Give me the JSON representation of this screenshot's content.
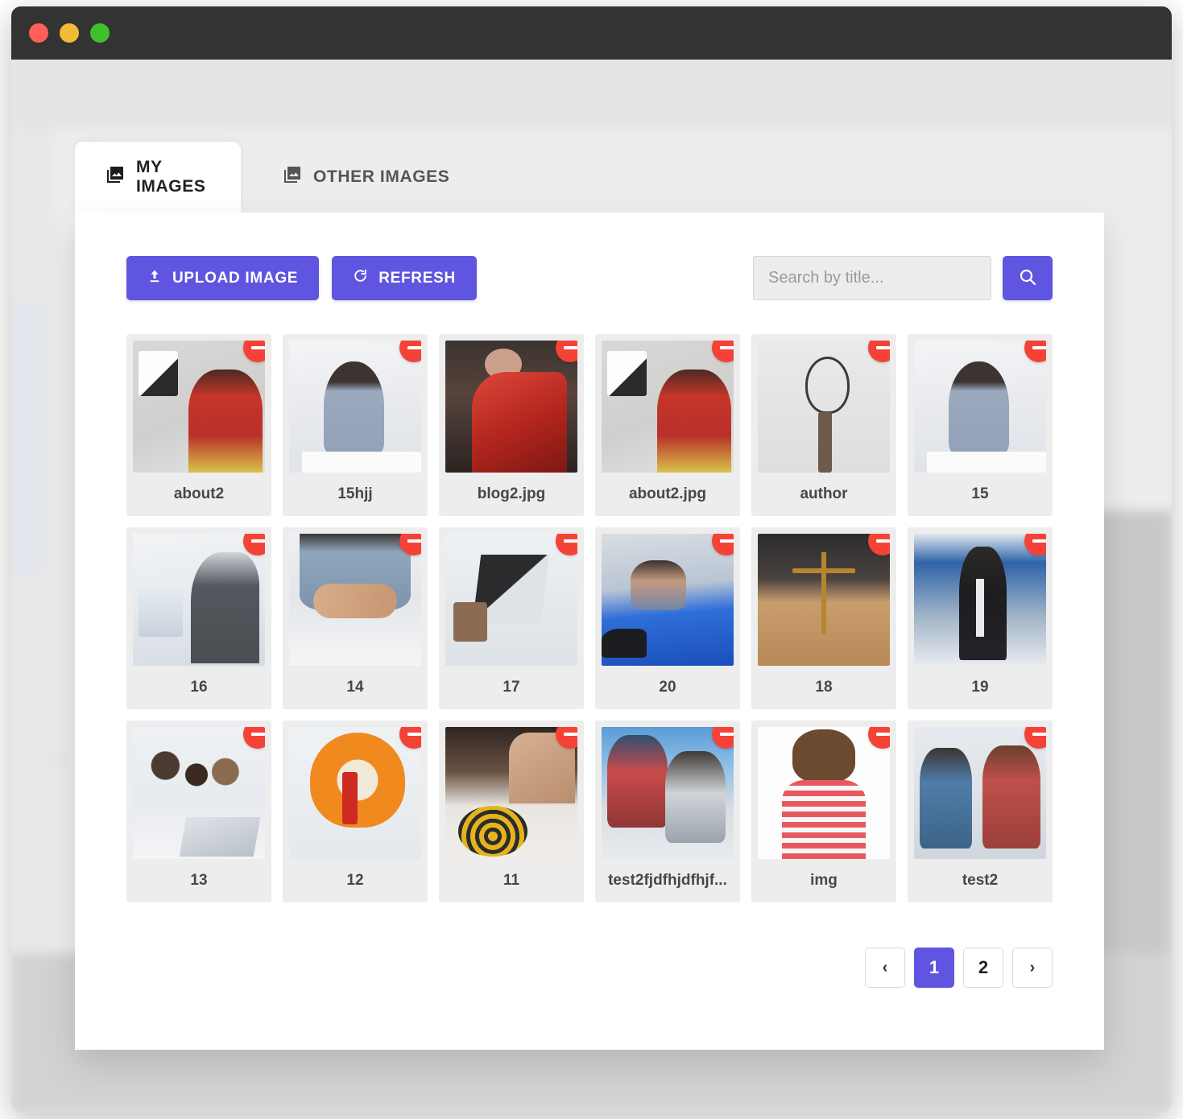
{
  "window": {
    "traffic_lights": [
      "close",
      "minimize",
      "maximize"
    ]
  },
  "tabs": [
    {
      "id": "my-images",
      "label": "MY IMAGES",
      "icon": "photo-library-icon",
      "active": true
    },
    {
      "id": "other-images",
      "label": "OTHER IMAGES",
      "icon": "photo-library-icon",
      "active": false
    }
  ],
  "toolbar": {
    "upload_label": "UPLOAD IMAGE",
    "upload_icon": "upload-icon",
    "refresh_label": "REFRESH",
    "refresh_icon": "refresh-icon"
  },
  "search": {
    "placeholder": "Search by title...",
    "value": "",
    "button_icon": "search-icon"
  },
  "colors": {
    "accent": "#6055e0",
    "remove": "#f44336",
    "card_bg": "#ededed",
    "panel_bg": "#ffffff",
    "titlebar": "#333333"
  },
  "grid": {
    "remove_icon": "minus-circle-icon",
    "items": [
      {
        "title": "about2",
        "art": "art-studio"
      },
      {
        "title": "15hjj",
        "art": "art-desk-woman"
      },
      {
        "title": "blog2.jpg",
        "art": "art-reddress"
      },
      {
        "title": "about2.jpg",
        "art": "art-studio"
      },
      {
        "title": "author",
        "art": "art-bulb"
      },
      {
        "title": "15",
        "art": "art-desk-woman"
      },
      {
        "title": "16",
        "art": "art-vr"
      },
      {
        "title": "14",
        "art": "art-handshake"
      },
      {
        "title": "17",
        "art": "art-laptops"
      },
      {
        "title": "20",
        "art": "art-car"
      },
      {
        "title": "18",
        "art": "art-scales"
      },
      {
        "title": "19",
        "art": "art-suit"
      },
      {
        "title": "13",
        "art": "art-team"
      },
      {
        "title": "12",
        "art": "art-eggchair"
      },
      {
        "title": "11",
        "art": "art-target"
      },
      {
        "title": "test2fjdfhjdfhjf...",
        "art": "art-family-plaid"
      },
      {
        "title": "img",
        "art": "art-pointing"
      },
      {
        "title": "test2",
        "art": "art-family-couch"
      }
    ]
  },
  "pagination": {
    "prev_icon": "chevron-left-icon",
    "next_icon": "chevron-right-icon",
    "pages": [
      "1",
      "2"
    ],
    "current_page": "1"
  }
}
